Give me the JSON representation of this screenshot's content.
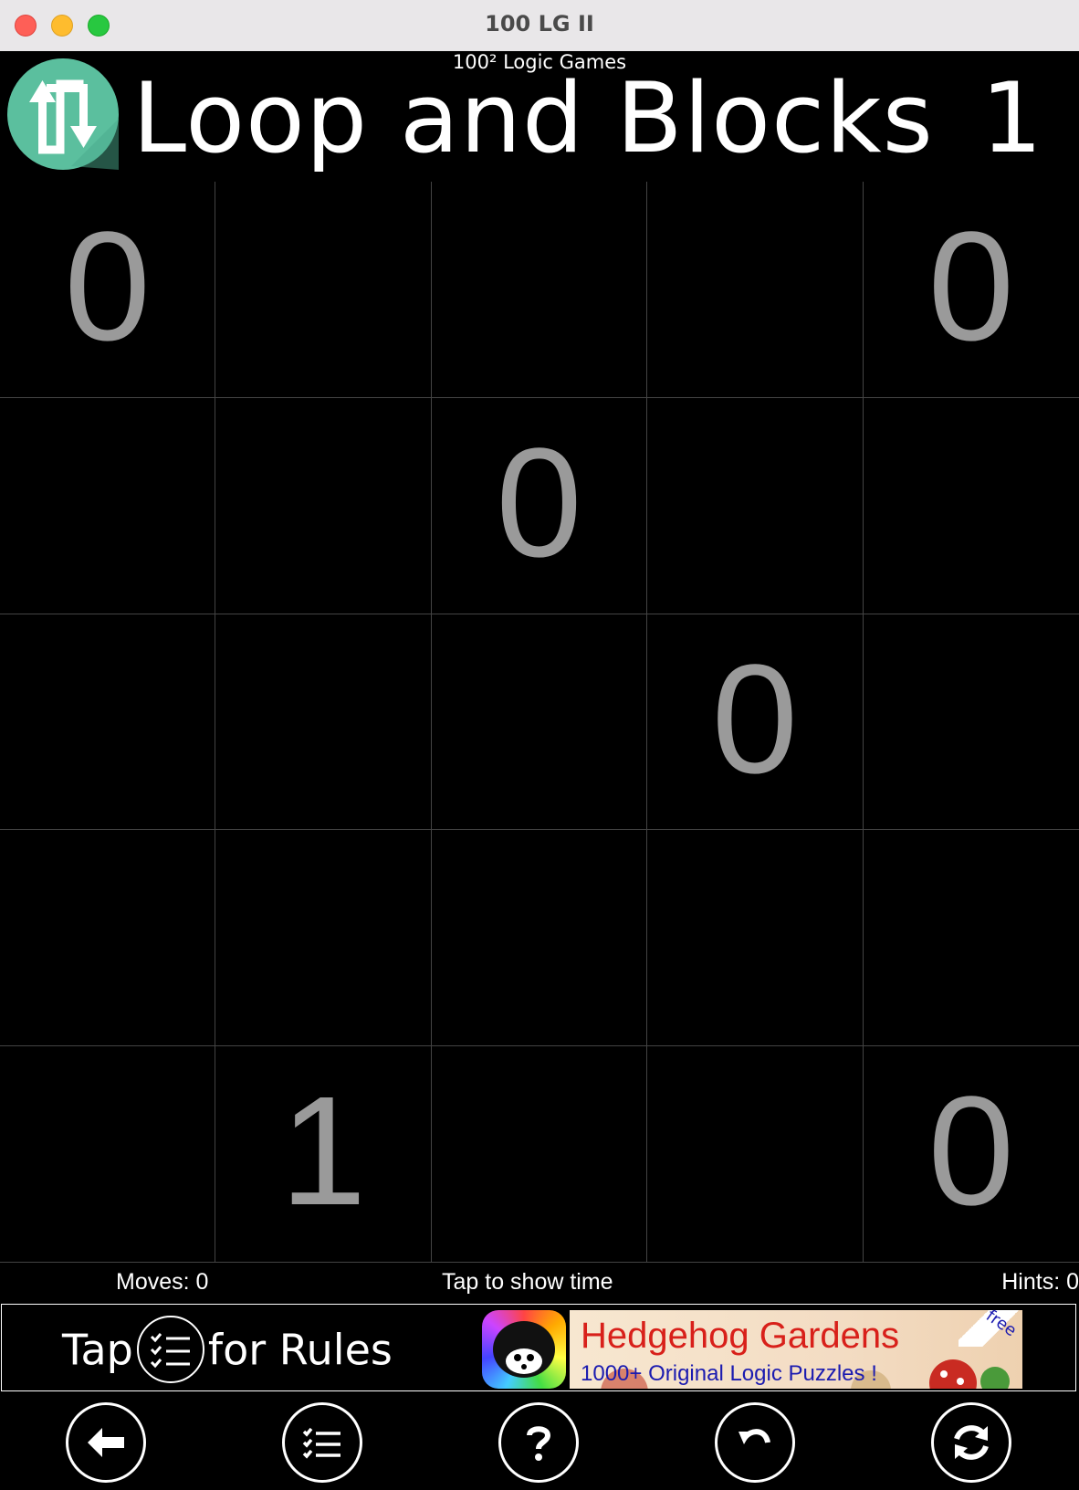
{
  "window": {
    "title": "100 LG II"
  },
  "header": {
    "subtitle": "100² Logic Games",
    "title": "Loop and Blocks",
    "puzzle_number": "1",
    "logo_icon": "swap-arrows-icon"
  },
  "grid": {
    "rows": 5,
    "cols": 5,
    "cells": [
      "0",
      "",
      "",
      "",
      "0",
      "",
      "",
      "0",
      "",
      "",
      "",
      "",
      "",
      "0",
      "",
      "",
      "",
      "",
      "",
      "",
      "",
      "1",
      "",
      "",
      "0"
    ]
  },
  "status": {
    "moves": "Moves: 0",
    "timer": "Tap to show time",
    "hints": "Hints: 0"
  },
  "banner": {
    "rules_prefix": "Tap",
    "rules_suffix": "for Rules",
    "ad_title": "Hedgehog Gardens",
    "ad_subtitle": "1000+ Original Logic Puzzles !",
    "ad_badge": "free"
  },
  "toolbar": {
    "buttons": [
      {
        "name": "back-button",
        "icon": "arrow-left-icon"
      },
      {
        "name": "rules-button",
        "icon": "checklist-icon"
      },
      {
        "name": "help-button",
        "icon": "question-icon"
      },
      {
        "name": "undo-button",
        "icon": "undo-icon"
      },
      {
        "name": "restart-button",
        "icon": "refresh-icon"
      }
    ]
  },
  "colors": {
    "logo": "#5bbf9e",
    "clue": "#9a9a9a",
    "grid_line": "#444444",
    "ad_title": "#d8201a",
    "ad_subtitle": "#1b1bb0"
  }
}
